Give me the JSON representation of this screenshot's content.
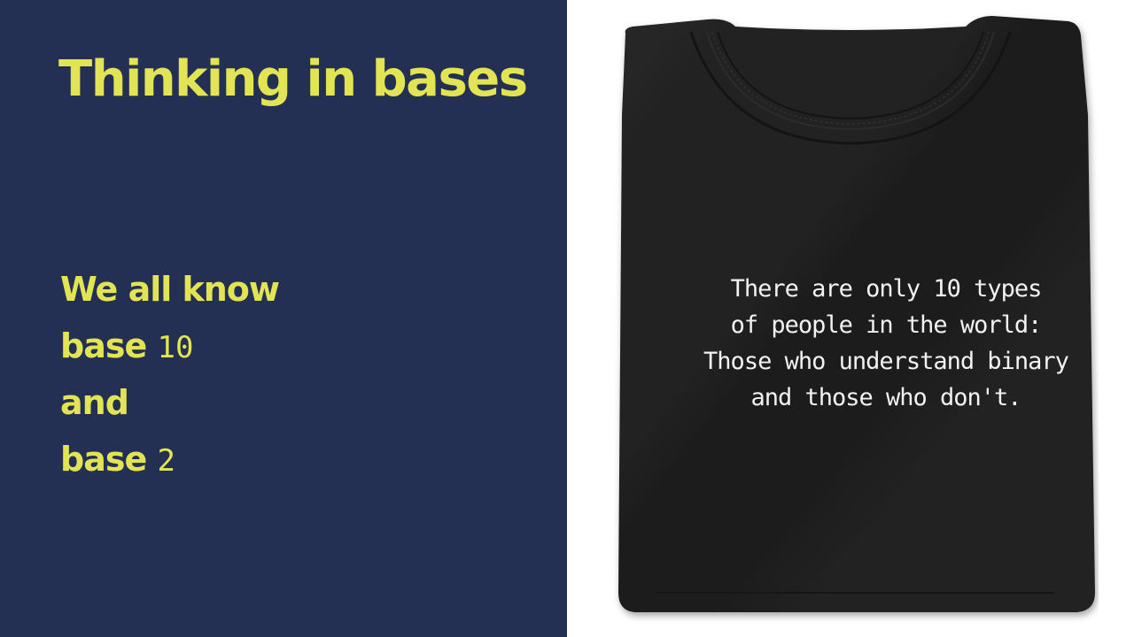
{
  "slide": {
    "title": "Thinking in bases",
    "lines": [
      {
        "text": "We all know",
        "mono": ""
      },
      {
        "text": "base ",
        "mono": "10"
      },
      {
        "text": "and",
        "mono": ""
      },
      {
        "text": "base ",
        "mono": "2"
      }
    ]
  },
  "shirt": {
    "icon": "t-shirt-image",
    "print_lines": [
      "There are only 10 types",
      "of people in the world:",
      "Those who understand binary",
      "and those who don't."
    ]
  },
  "colors": {
    "panel_background": "#233053",
    "accent_text": "#e3e453",
    "shirt": "#1f1f1f"
  }
}
